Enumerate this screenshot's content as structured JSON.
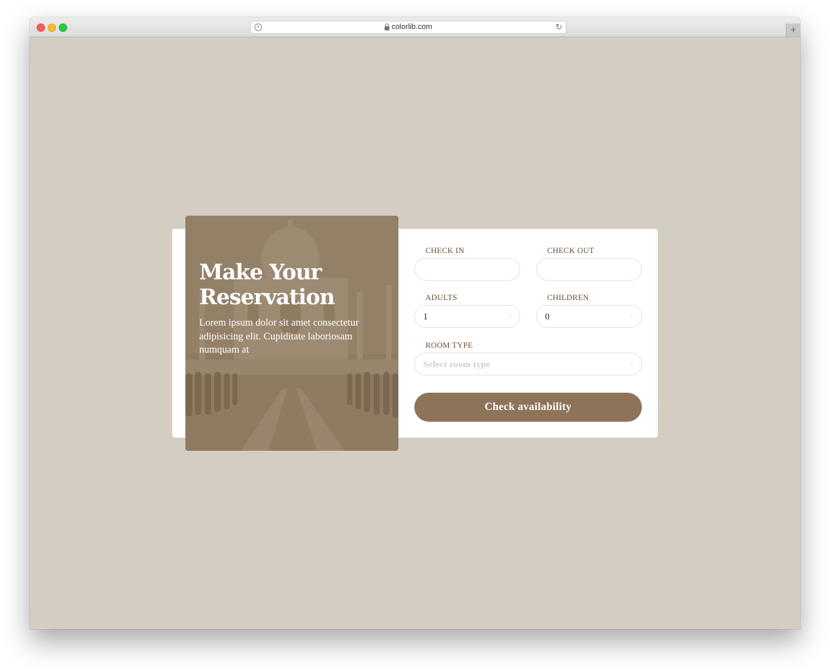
{
  "browser": {
    "url": "colorlib.com"
  },
  "hero": {
    "title": "Make Your Reservation",
    "text": "Lorem ipsum dolor sit amet consectetur adipisicing elit. Cupiditate laboriosam numquam at"
  },
  "form": {
    "check_in_label": "CHECK IN",
    "check_in_value": "",
    "check_out_label": "CHECK OUT",
    "check_out_value": "",
    "adults_label": "ADULTS",
    "adults_value": "1",
    "children_label": "CHILDREN",
    "children_value": "0",
    "room_type_label": "ROOM TYPE",
    "room_type_placeholder": "Select room type",
    "submit_label": "Check availability"
  },
  "colors": {
    "page_background": "#d4cdc2",
    "hero_overlay": "#8e7a61",
    "button": "#8d7459",
    "label_text": "#6b4d33"
  },
  "icons": {
    "dropdown": "arrow-down-icon",
    "lock": "lock-icon",
    "reload": "reload-icon"
  }
}
